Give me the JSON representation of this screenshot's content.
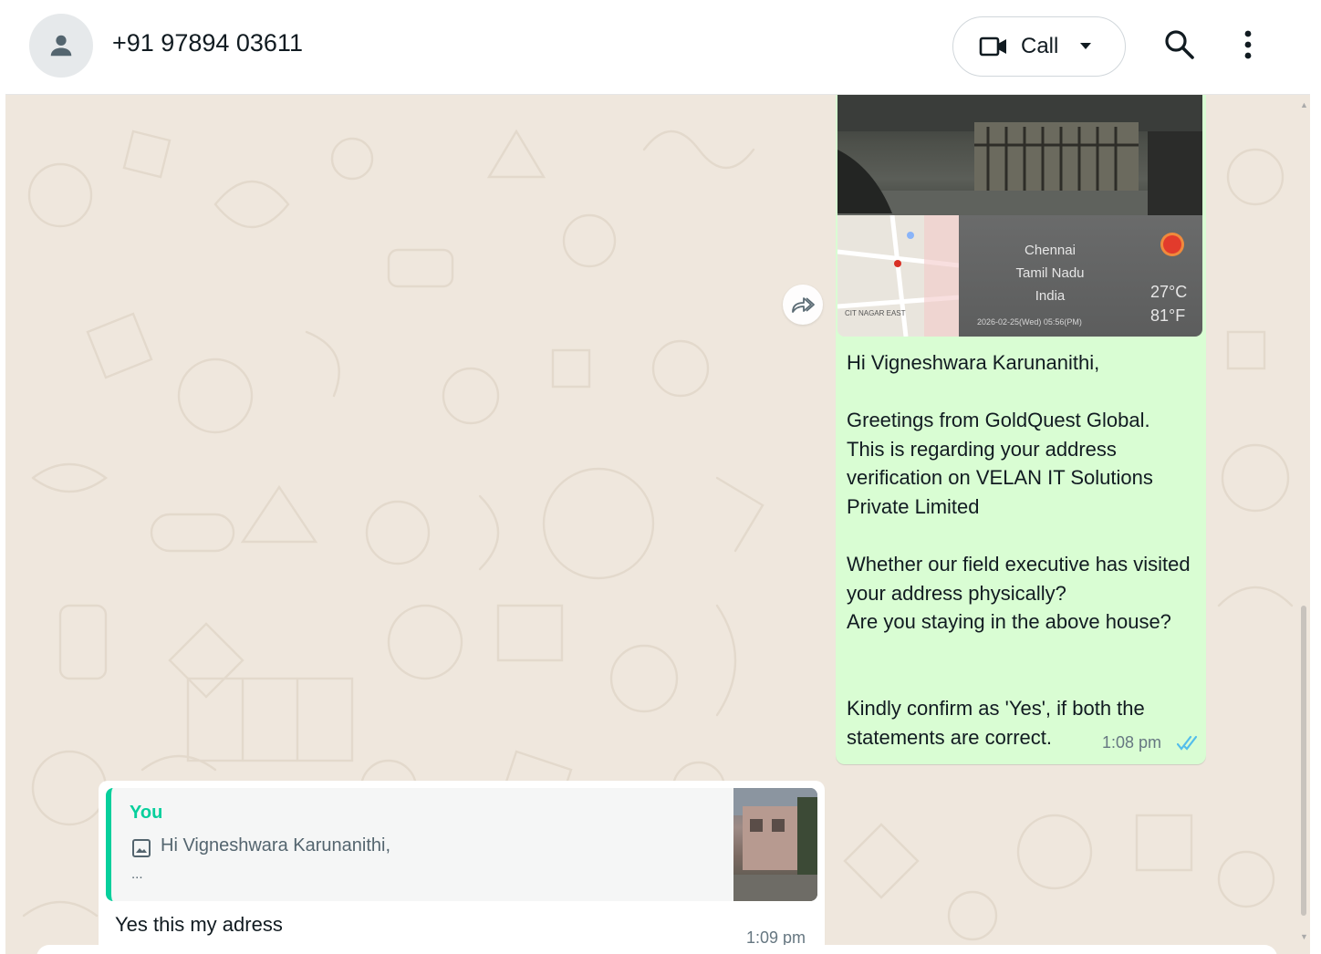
{
  "header": {
    "contact_name": "+91 97894 03611",
    "call_label": "Call"
  },
  "outgoing_message": {
    "image_stamp": {
      "city": "Chennai",
      "state": "Tamil Nadu",
      "country": "India",
      "temp_c": "27°C",
      "temp_f": "81°F",
      "datetime": "2026-02-25(Wed) 05:56(PM)",
      "map_area_label": "CIT NAGAR EAST"
    },
    "text": "Hi Vigneshwara Karunanithi,\n\nGreetings from GoldQuest Global.\nThis is regarding your address verification on VELAN IT Solutions Private Limited\n\nWhether our field executive has visited your address physically?\nAre you staying in the above house?\n\n\nKindly confirm as 'Yes', if both the statements are correct.",
    "time": "1:08 pm"
  },
  "incoming_message": {
    "quote_author": "You",
    "quote_text": "Hi Vigneshwara Karunanithi,",
    "quote_more": "...",
    "text": "Yes this my adress",
    "time": "1:09 pm"
  },
  "colors": {
    "chat_background": "#efe7dd",
    "outgoing_bubble": "#d9fdd3",
    "incoming_bubble": "#ffffff",
    "quote_accent": "#06cf9c",
    "read_ticks": "#53bdeb"
  }
}
